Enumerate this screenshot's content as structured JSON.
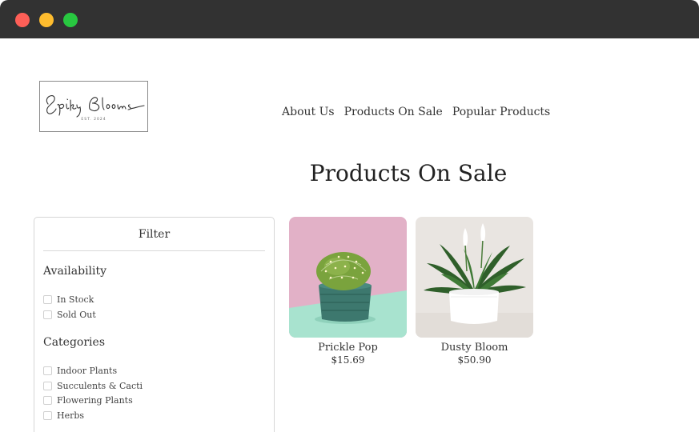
{
  "window": {
    "controls": [
      "close",
      "minimize",
      "maximize"
    ]
  },
  "logo": {
    "brand": "Spiky Blooms",
    "established": "EST. 2024"
  },
  "nav": {
    "items": [
      {
        "label": "About Us"
      },
      {
        "label": "Products On Sale"
      },
      {
        "label": "Popular Products"
      }
    ]
  },
  "page": {
    "title": "Products On Sale"
  },
  "filter": {
    "title": "Filter",
    "availability": {
      "heading": "Availability",
      "options": [
        {
          "label": "In Stock"
        },
        {
          "label": "Sold Out"
        }
      ]
    },
    "categories": {
      "heading": "Categories",
      "options": [
        {
          "label": "Indoor Plants"
        },
        {
          "label": "Succulents & Cacti"
        },
        {
          "label": "Flowering Plants"
        },
        {
          "label": "Herbs"
        }
      ]
    }
  },
  "products": [
    {
      "name": "Prickle Pop",
      "price": "$15.69",
      "image": "cactus-teal-pot"
    },
    {
      "name": "Dusty Bloom",
      "price": "$50.90",
      "image": "peace-lily-white-pot"
    }
  ],
  "colors": {
    "titlebar": "#323232",
    "close": "#fe5f57",
    "minimize": "#febc2e",
    "maximize": "#28c840"
  }
}
